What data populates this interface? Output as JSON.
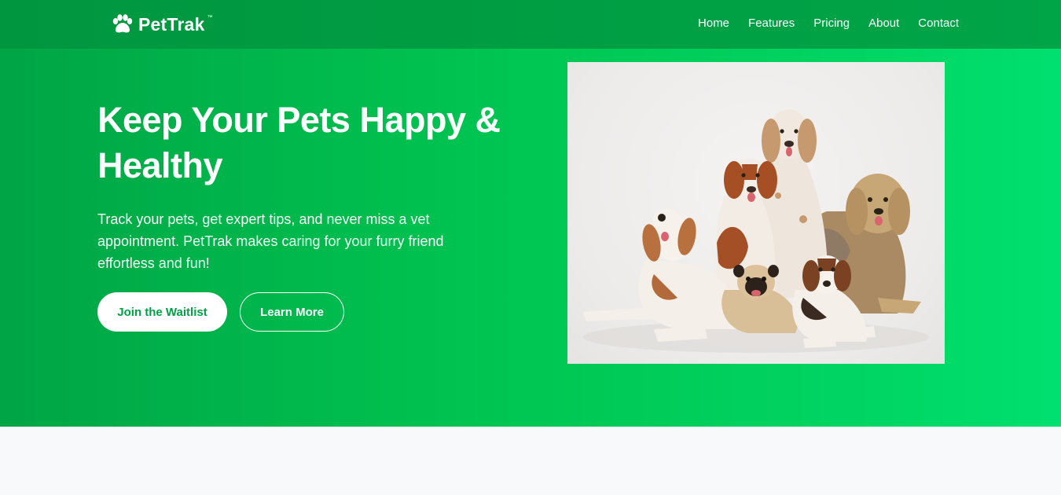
{
  "brand": {
    "name": "PetTrak",
    "trademark": "™",
    "logo_icon": "paw-icon",
    "colors": {
      "primary_green": "#00a545",
      "accent_green": "#00e070",
      "white": "#ffffff"
    }
  },
  "nav": {
    "items": [
      {
        "label": "Home"
      },
      {
        "label": "Features"
      },
      {
        "label": "Pricing"
      },
      {
        "label": "About"
      },
      {
        "label": "Contact"
      }
    ]
  },
  "hero": {
    "headline": "Keep Your Pets Happy & Healthy",
    "subtext": "Track your pets, get expert tips, and never miss a vet appointment. PetTrak makes caring for your furry friend effortless and fun!",
    "primary_button": "Join the Waitlist",
    "secondary_button": "Learn More",
    "image": "group-of-dogs-photo"
  }
}
